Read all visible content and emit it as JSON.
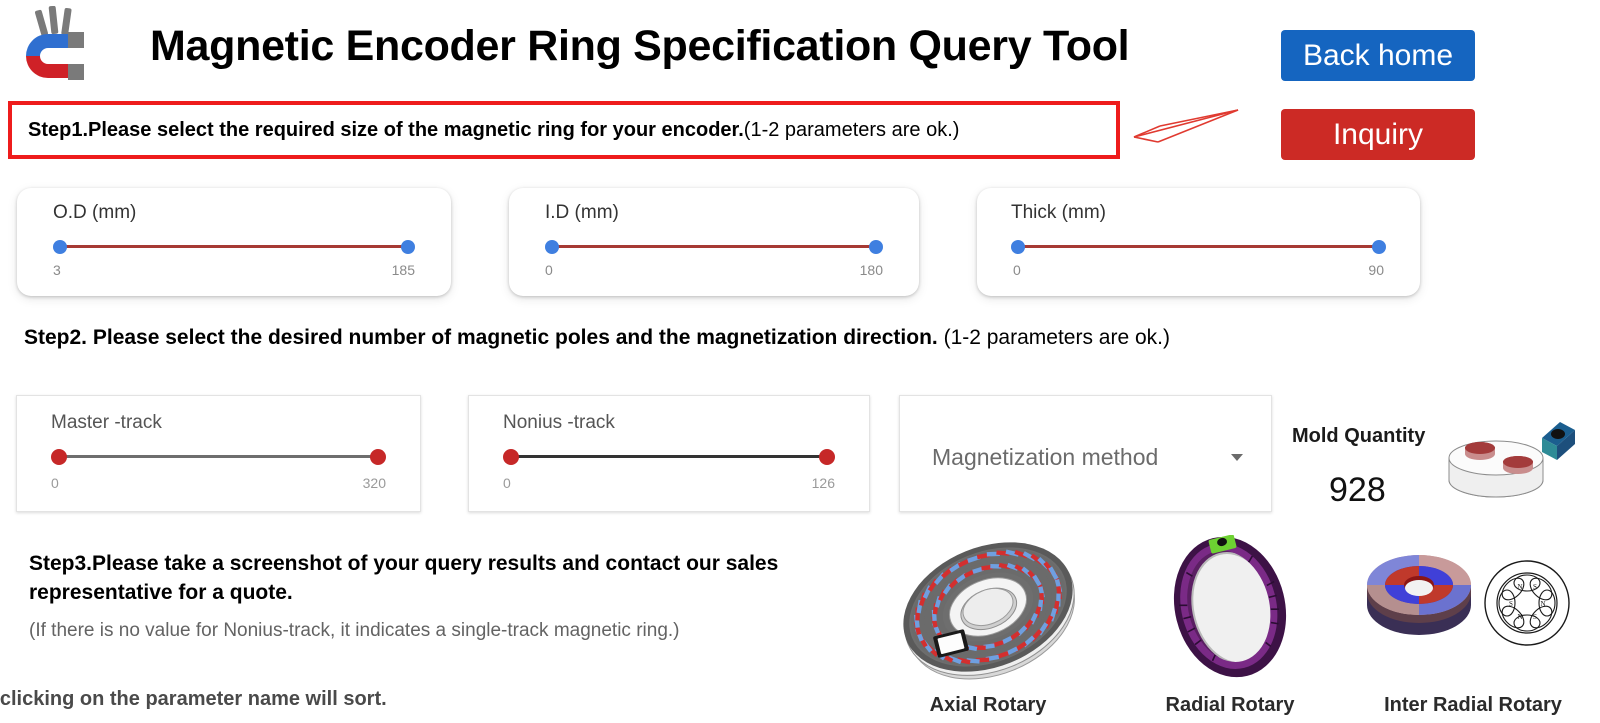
{
  "header": {
    "title": "Magnetic Encoder Ring Specification Query Tool",
    "logo_icon": "horseshoe-magnet-icon",
    "back_home_label": "Back home",
    "inquiry_label": "Inquiry"
  },
  "step1": {
    "text_bold": "Step1.Please select the required size of the magnetic ring for your encoder.",
    "text_light": "(1-2 parameters are ok.)",
    "arrow_icon": "left-arrow-icon",
    "arrow_color": "#e03a30",
    "border_color": "#ee1c1c",
    "sliders": [
      {
        "label": "O.D (mm)",
        "min": "3",
        "max": "185"
      },
      {
        "label": "I.D (mm)",
        "min": "0",
        "max": "180"
      },
      {
        "label": "Thick (mm)",
        "min": "0",
        "max": "90"
      }
    ]
  },
  "step2": {
    "text_bold": "Step2. Please select the desired number of magnetic poles and the magnetization direction.",
    "text_light": "(1-2 parameters are ok.)",
    "sliders": [
      {
        "label": "Master -track",
        "min": "0",
        "max": "320"
      },
      {
        "label": "Nonius -track",
        "min": "0",
        "max": "126"
      }
    ],
    "dropdown": {
      "label": "Magnetization method",
      "caret_icon": "chevron-down-icon"
    },
    "mold": {
      "label": "Mold Quantity",
      "value": "928",
      "image_icon": "mold-die-icon"
    }
  },
  "step3": {
    "text": "Step3.Please take a screenshot of your query results and contact our sales representative for a quote.",
    "note": "(If there is no value for Nonius-track, it indicates a single-track magnetic ring.)"
  },
  "footnote": "ery results | clicking on the parameter name will sort.",
  "figures": [
    {
      "caption": "Axial Rotary",
      "icon": "axial-rotary-ring-icon"
    },
    {
      "caption": "Radial Rotary",
      "icon": "radial-rotary-ring-icon"
    },
    {
      "caption": "Inter Radial Rotary",
      "icon": "inter-radial-rotary-ring-icon"
    }
  ],
  "colors": {
    "primary_blue": "#1565c0",
    "primary_red": "#cc2a25",
    "slider_knob_blue": "#3f7fe0",
    "slider_knob_red": "#c62828"
  }
}
